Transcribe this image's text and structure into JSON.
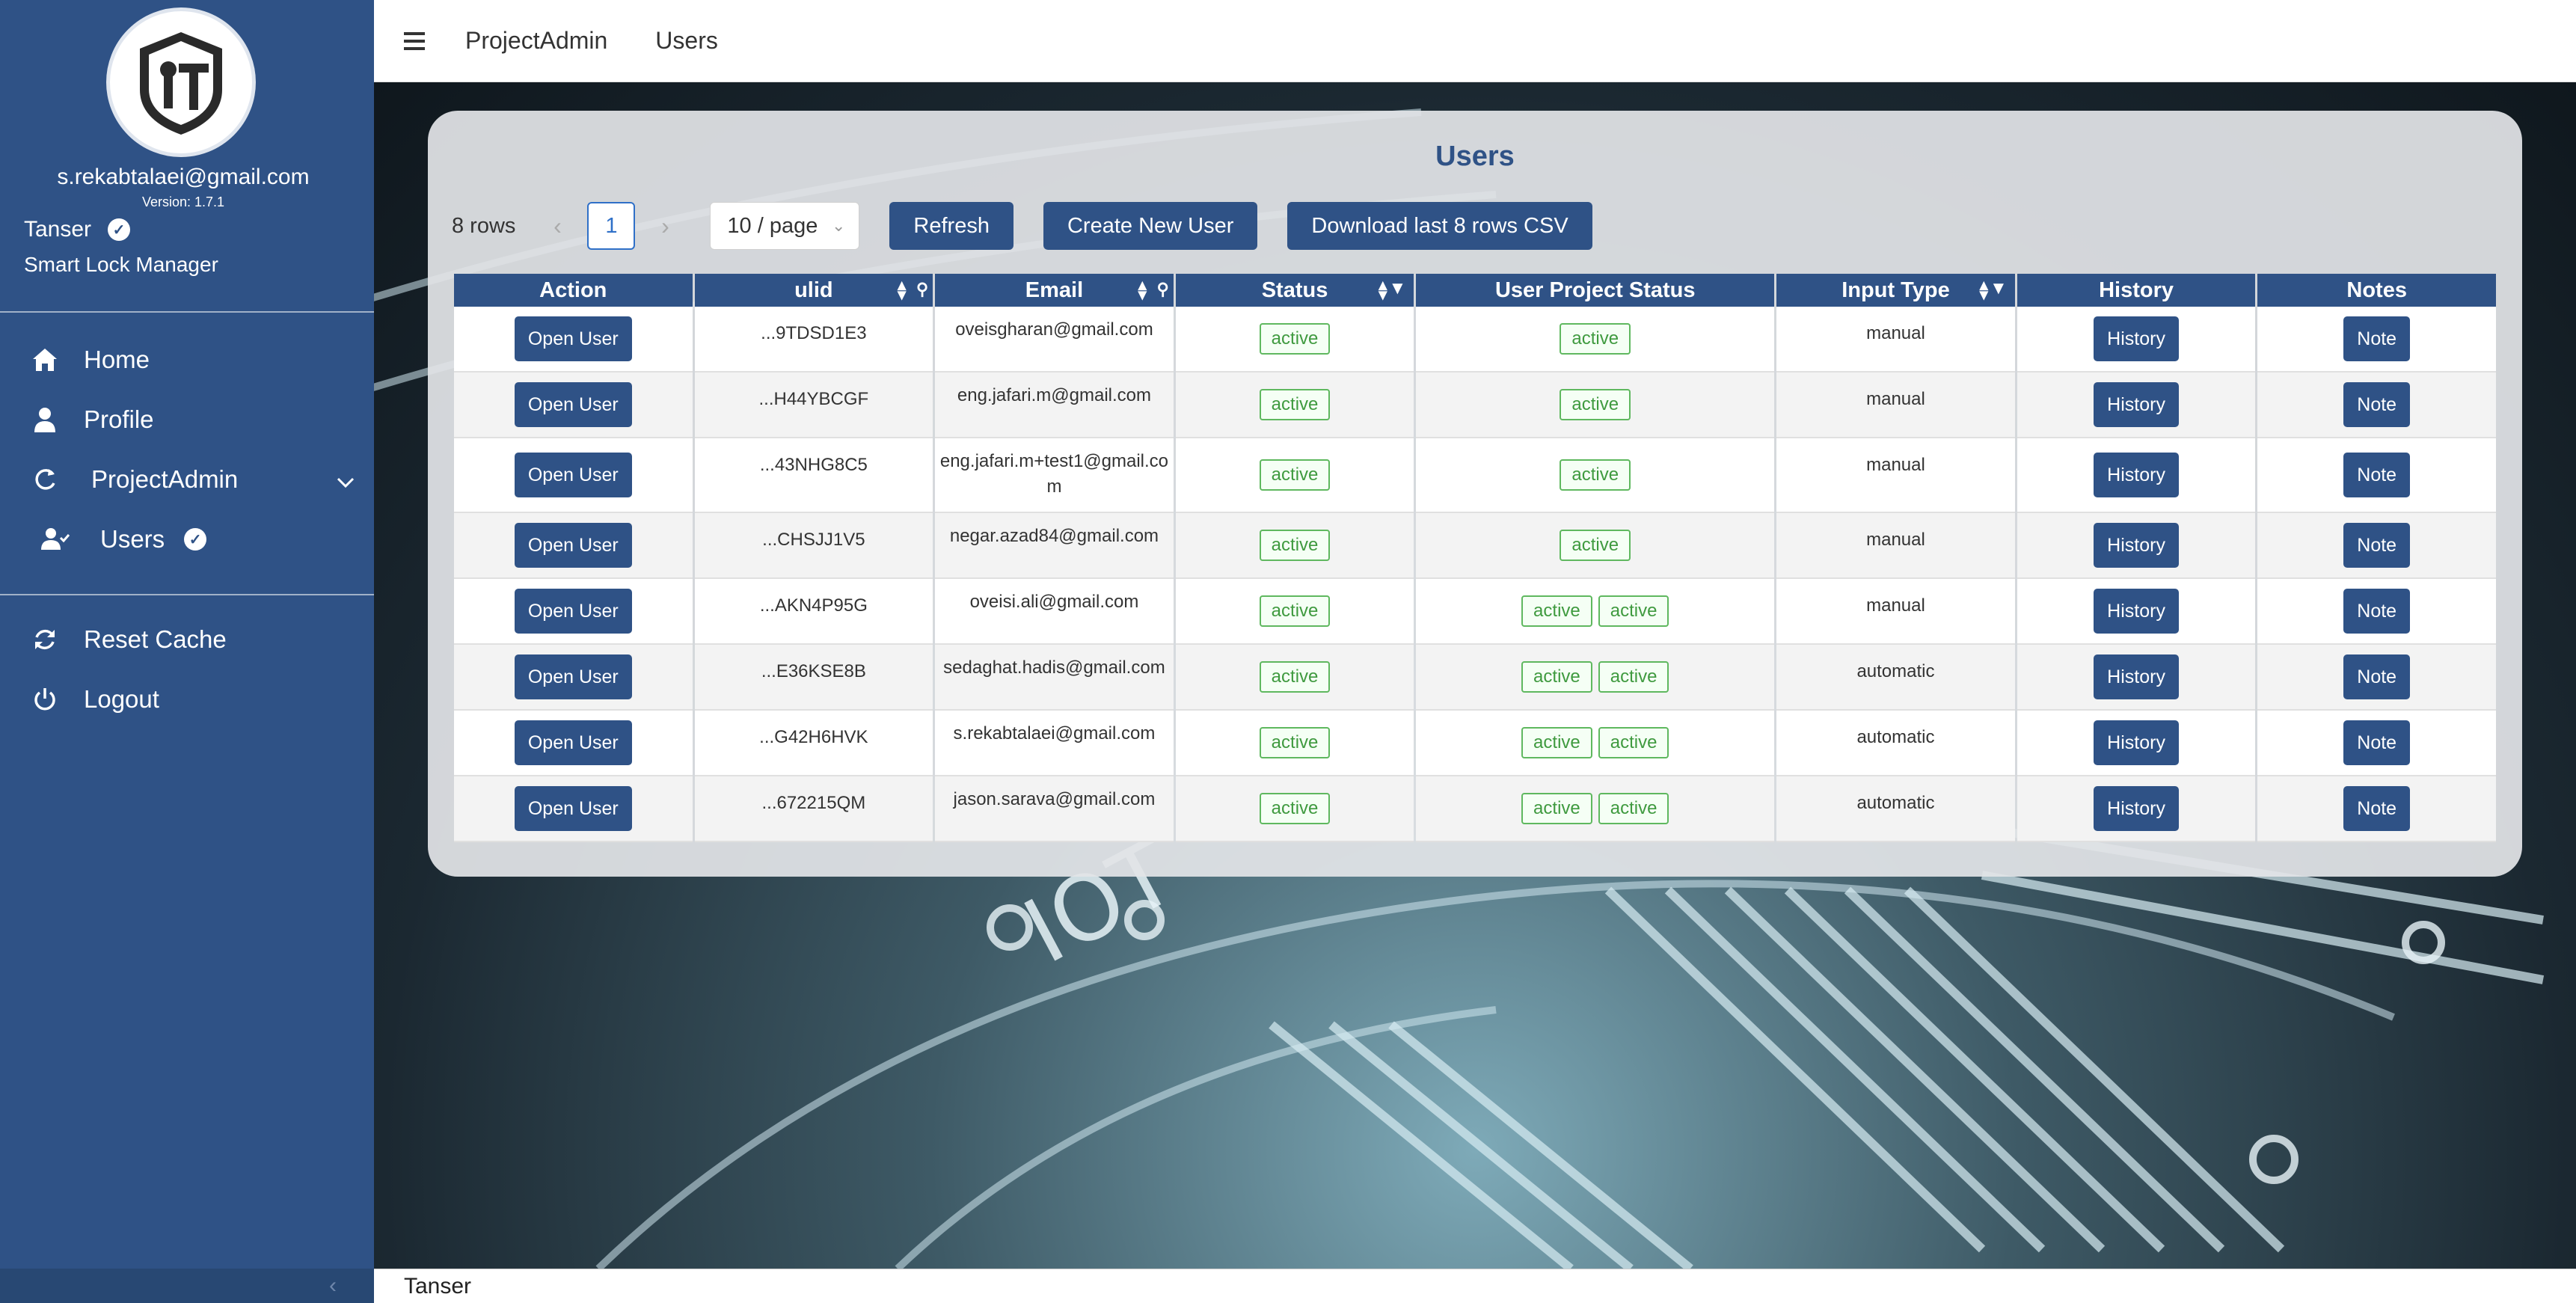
{
  "sidebar": {
    "email": "s.rekabtalaei@gmail.com",
    "version": "Version: 1.7.1",
    "tenant": "Tanser",
    "project": "Smart Lock Manager",
    "logo_text": "IT",
    "nav": {
      "home": "Home",
      "profile": "Profile",
      "projectadmin": "ProjectAdmin",
      "users": "Users",
      "reset_cache": "Reset Cache",
      "logout": "Logout"
    },
    "collapse_glyph": "‹"
  },
  "header": {
    "crumbs": [
      "ProjectAdmin",
      "Users"
    ]
  },
  "card": {
    "title": "Users",
    "rows_count": "8 rows",
    "current_page": "1",
    "page_size": "10 / page",
    "refresh": "Refresh",
    "create": "Create New User",
    "download": "Download last 8 rows CSV"
  },
  "table": {
    "columns": [
      "Action",
      "ulid",
      "Email",
      "Status",
      "User Project Status",
      "Input Type",
      "History",
      "Notes"
    ],
    "action_label": "Open User",
    "history_label": "History",
    "note_label": "Note",
    "rows": [
      {
        "ulid": "...9TDSD1E3",
        "email": "oveisgharan@gmail.com",
        "status": "active",
        "project_status": [
          "active"
        ],
        "input_type": "manual"
      },
      {
        "ulid": "...H44YBCGF",
        "email": "eng.jafari.m@gmail.com",
        "status": "active",
        "project_status": [
          "active"
        ],
        "input_type": "manual"
      },
      {
        "ulid": "...43NHG8C5",
        "email": "eng.jafari.m+test1@gmail.com",
        "status": "active",
        "project_status": [
          "active"
        ],
        "input_type": "manual"
      },
      {
        "ulid": "...CHSJJ1V5",
        "email": "negar.azad84@gmail.com",
        "status": "active",
        "project_status": [
          "active"
        ],
        "input_type": "manual"
      },
      {
        "ulid": "...AKN4P95G",
        "email": "oveisi.ali@gmail.com",
        "status": "active",
        "project_status": [
          "active",
          "active"
        ],
        "input_type": "manual"
      },
      {
        "ulid": "...E36KSE8B",
        "email": "sedaghat.hadis@gmail.com",
        "status": "active",
        "project_status": [
          "active",
          "active"
        ],
        "input_type": "automatic"
      },
      {
        "ulid": "...G42H6HVK",
        "email": "s.rekabtalaei@gmail.com",
        "status": "active",
        "project_status": [
          "active",
          "active"
        ],
        "input_type": "automatic"
      },
      {
        "ulid": "...672215QM",
        "email": "jason.sarava@gmail.com",
        "status": "active",
        "project_status": [
          "active",
          "active"
        ],
        "input_type": "automatic"
      }
    ]
  },
  "footer": {
    "text": "Tanser"
  },
  "colors": {
    "primary": "#2f5286",
    "active_tag": "#3f9a3f",
    "pager_accent": "#2f70c8"
  }
}
